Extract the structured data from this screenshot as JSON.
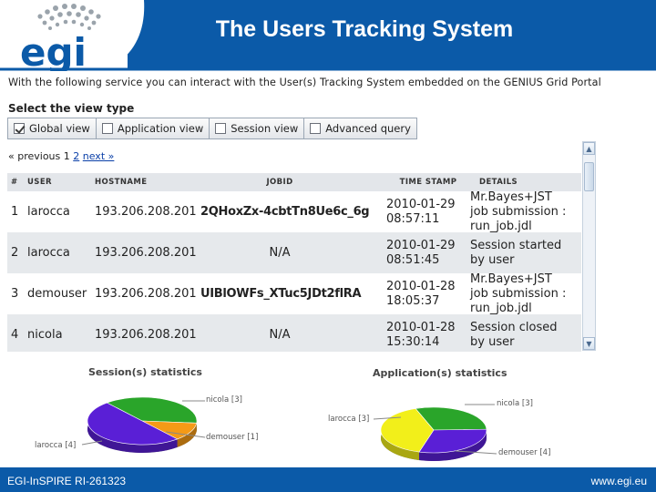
{
  "header": {
    "title": "The Users Tracking System",
    "logo_text": "egi",
    "band_color": "#0b5aa8"
  },
  "intro": "With the following service you can interact with the User(s) Tracking System embedded on the GENIUS Grid Portal",
  "view_type": {
    "heading": "Select the view type",
    "tabs": [
      {
        "label": "Global view",
        "checked": true
      },
      {
        "label": "Application view",
        "checked": false
      },
      {
        "label": "Session view",
        "checked": false
      },
      {
        "label": "Advanced query",
        "checked": false
      }
    ]
  },
  "pager": {
    "prev": "« previous",
    "page1": "1",
    "page2": "2",
    "next": "next »"
  },
  "table": {
    "headers": {
      "num": "#",
      "user": "USER",
      "hostname": "HOSTNAME",
      "jobid": "JOBID",
      "timestamp": "TIME STAMP",
      "details": "DETAILS"
    },
    "rows": [
      {
        "num": "1",
        "user": "larocca",
        "hostname": "193.206.208.201",
        "jobid": "2QHoxZx-4cbtTn8Ue6c_6g",
        "time1": "2010-01-29",
        "time2": "08:57:11",
        "d1": "Mr.Bayes+JST",
        "d2": "job submission :",
        "d3": "run_job.jdl"
      },
      {
        "num": "2",
        "user": "larocca",
        "hostname": "193.206.208.201",
        "jobid": "N/A",
        "time1": "2010-01-29",
        "time2": "08:51:45",
        "d1": "Session started",
        "d2": "by user",
        "d3": ""
      },
      {
        "num": "3",
        "user": "demouser",
        "hostname": "193.206.208.201",
        "jobid": "UIBlOWFs_XTuc5JDt2flRA",
        "time1": "2010-01-28",
        "time2": "18:05:37",
        "d1": "Mr.Bayes+JST",
        "d2": "job submission :",
        "d3": "run_job.jdl"
      },
      {
        "num": "4",
        "user": "nicola",
        "hostname": "193.206.208.201",
        "jobid": "N/A",
        "time1": "2010-01-28",
        "time2": "15:30:14",
        "d1": "Session closed",
        "d2": "by user",
        "d3": ""
      }
    ]
  },
  "session_stats": {
    "title": "Session(s) statistics",
    "labels": {
      "nicola": "nicola [3]",
      "demouser": "demouser [1]",
      "larocca": "larocca [4]"
    }
  },
  "application_stats": {
    "title": "Application(s) statistics",
    "labels": {
      "nicola": "nicola [3]",
      "larocca": "larocca [3]",
      "demouser": "demouser [4]"
    }
  },
  "chart_data": [
    {
      "type": "pie",
      "title": "Session(s) statistics",
      "categories": [
        "nicola",
        "demouser",
        "larocca"
      ],
      "values": [
        3,
        1,
        4
      ],
      "colors": [
        "#2aa52a",
        "#f59a16",
        "#5a1fd6"
      ]
    },
    {
      "type": "pie",
      "title": "Application(s) statistics",
      "categories": [
        "nicola",
        "larocca",
        "demouser"
      ],
      "values": [
        3,
        3,
        4
      ],
      "colors": [
        "#2aa52a",
        "#5a1fd6",
        "#f2ef1a"
      ]
    }
  ],
  "footer": {
    "left": "EGI-InSPIRE RI-261323",
    "right": "www.egi.eu"
  }
}
